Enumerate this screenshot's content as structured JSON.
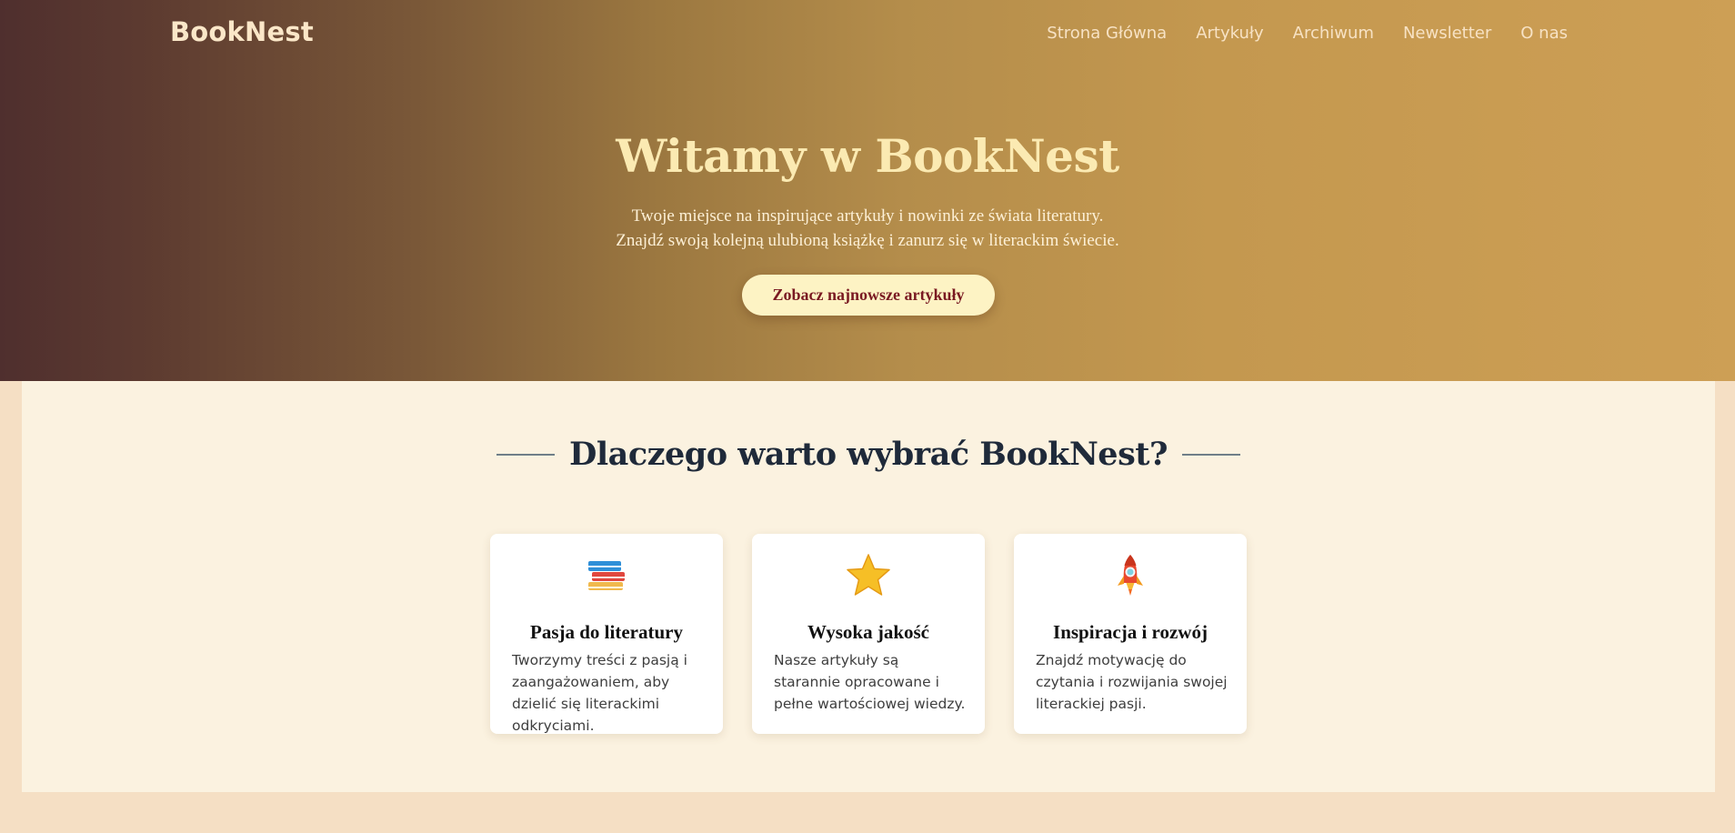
{
  "header": {
    "brand": "BookNest",
    "nav": [
      "Strona Główna",
      "Artykuły",
      "Archiwum",
      "Newsletter",
      "O nas"
    ]
  },
  "hero": {
    "title": "Witamy w BookNest",
    "subtitle_line1": "Twoje miejsce na inspirujące artykuły i nowinki ze świata literatury.",
    "subtitle_line2": "Znajdź swoją kolejną ulubioną książkę i zanurz się w literackim świecie.",
    "cta_label": "Zobacz najnowsze artykuły"
  },
  "features": {
    "title": "Dlaczego warto wybrać BookNest?",
    "cards": [
      {
        "icon": "books-icon",
        "title": "Pasja do literatury",
        "text": "Tworzymy treści z pasją i zaangażowaniem, aby dzielić się literackimi odkryciami."
      },
      {
        "icon": "star-icon",
        "title": "Wysoka jakość",
        "text": "Nasze artykuły są starannie opracowane i pełne wartościowej wiedzy."
      },
      {
        "icon": "rocket-icon",
        "title": "Inspiracja i rozwój",
        "text": "Znajdź motywację do czytania i rozwijania swojej literackiej pasji."
      }
    ]
  },
  "colors": {
    "hero_gradient_start": "#4f2f2e",
    "hero_gradient_end": "#cd9f55",
    "hero_title": "#fbeab2",
    "cta_bg": "#fdf3c4",
    "cta_text": "#7a1a22",
    "section_bg": "#fbf2e0",
    "page_bg": "#f5dfc4",
    "heading": "#1f2a3a"
  }
}
